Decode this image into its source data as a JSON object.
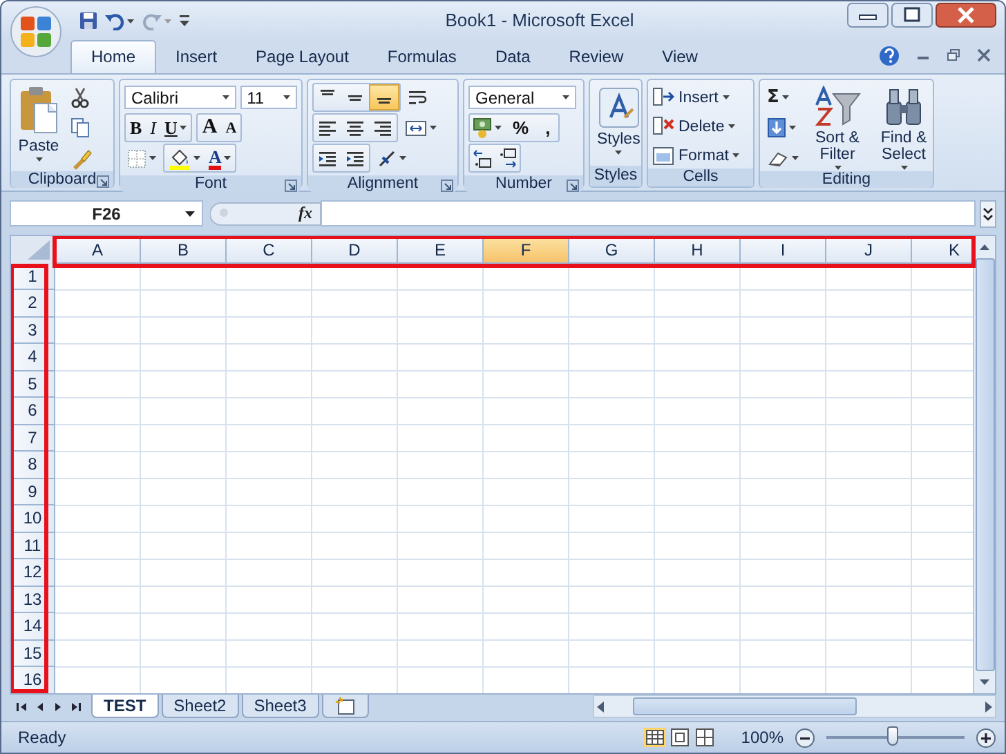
{
  "window": {
    "title": "Book1 - Microsoft Excel"
  },
  "tabs": [
    {
      "label": "Home",
      "selected": true
    },
    {
      "label": "Insert",
      "selected": false
    },
    {
      "label": "Page Layout",
      "selected": false
    },
    {
      "label": "Formulas",
      "selected": false
    },
    {
      "label": "Data",
      "selected": false
    },
    {
      "label": "Review",
      "selected": false
    },
    {
      "label": "View",
      "selected": false
    }
  ],
  "ribbon": [
    {
      "kind": "clipboard",
      "label": "Clipboard",
      "paste": "Paste"
    },
    {
      "kind": "font",
      "label": "Font",
      "font_name": "Calibri",
      "font_size": "11",
      "bold": "B",
      "italic": "I",
      "underline": "U",
      "grow": "A",
      "shrink": "A",
      "font_color": "A"
    },
    {
      "kind": "alignment",
      "label": "Alignment",
      "vertical": [
        {
          "kind": "top",
          "selected": false
        },
        {
          "kind": "middle",
          "selected": false
        },
        {
          "kind": "bottom",
          "selected": true
        }
      ]
    },
    {
      "kind": "number",
      "label": "Number",
      "format": "General",
      "percent": "%",
      "comma": ","
    },
    {
      "kind": "styles",
      "label": "Styles",
      "button": "Styles"
    },
    {
      "kind": "cells",
      "label": "Cells",
      "buttons": [
        "Insert",
        "Delete",
        "Format"
      ]
    },
    {
      "kind": "editing",
      "label": "Editing",
      "sum": "Σ",
      "sort": "Sort & Filter",
      "find": "Find & Select"
    }
  ],
  "formula_bar": {
    "name_box": "F26",
    "function_label": "fx"
  },
  "sheet": {
    "columns": [
      {
        "label": "A",
        "selected": false
      },
      {
        "label": "B",
        "selected": false
      },
      {
        "label": "C",
        "selected": false
      },
      {
        "label": "D",
        "selected": false
      },
      {
        "label": "E",
        "selected": false
      },
      {
        "label": "F",
        "selected": true
      },
      {
        "label": "G",
        "selected": false
      },
      {
        "label": "H",
        "selected": false
      },
      {
        "label": "I",
        "selected": false
      },
      {
        "label": "J",
        "selected": false
      },
      {
        "label": "K",
        "selected": false
      }
    ],
    "rows": [
      "1",
      "2",
      "3",
      "4",
      "5",
      "6",
      "7",
      "8",
      "9",
      "10",
      "11",
      "12",
      "13",
      "14",
      "15",
      "16"
    ],
    "highlight_column_headers": true,
    "highlight_row_headers": true
  },
  "sheet_tabs": [
    {
      "label": "TEST",
      "selected": true
    },
    {
      "label": "Sheet2",
      "selected": false
    },
    {
      "label": "Sheet3",
      "selected": false
    }
  ],
  "status_bar": {
    "status": "Ready",
    "zoom": "100%",
    "zoom_level": {
      "level": 0.48
    }
  }
}
